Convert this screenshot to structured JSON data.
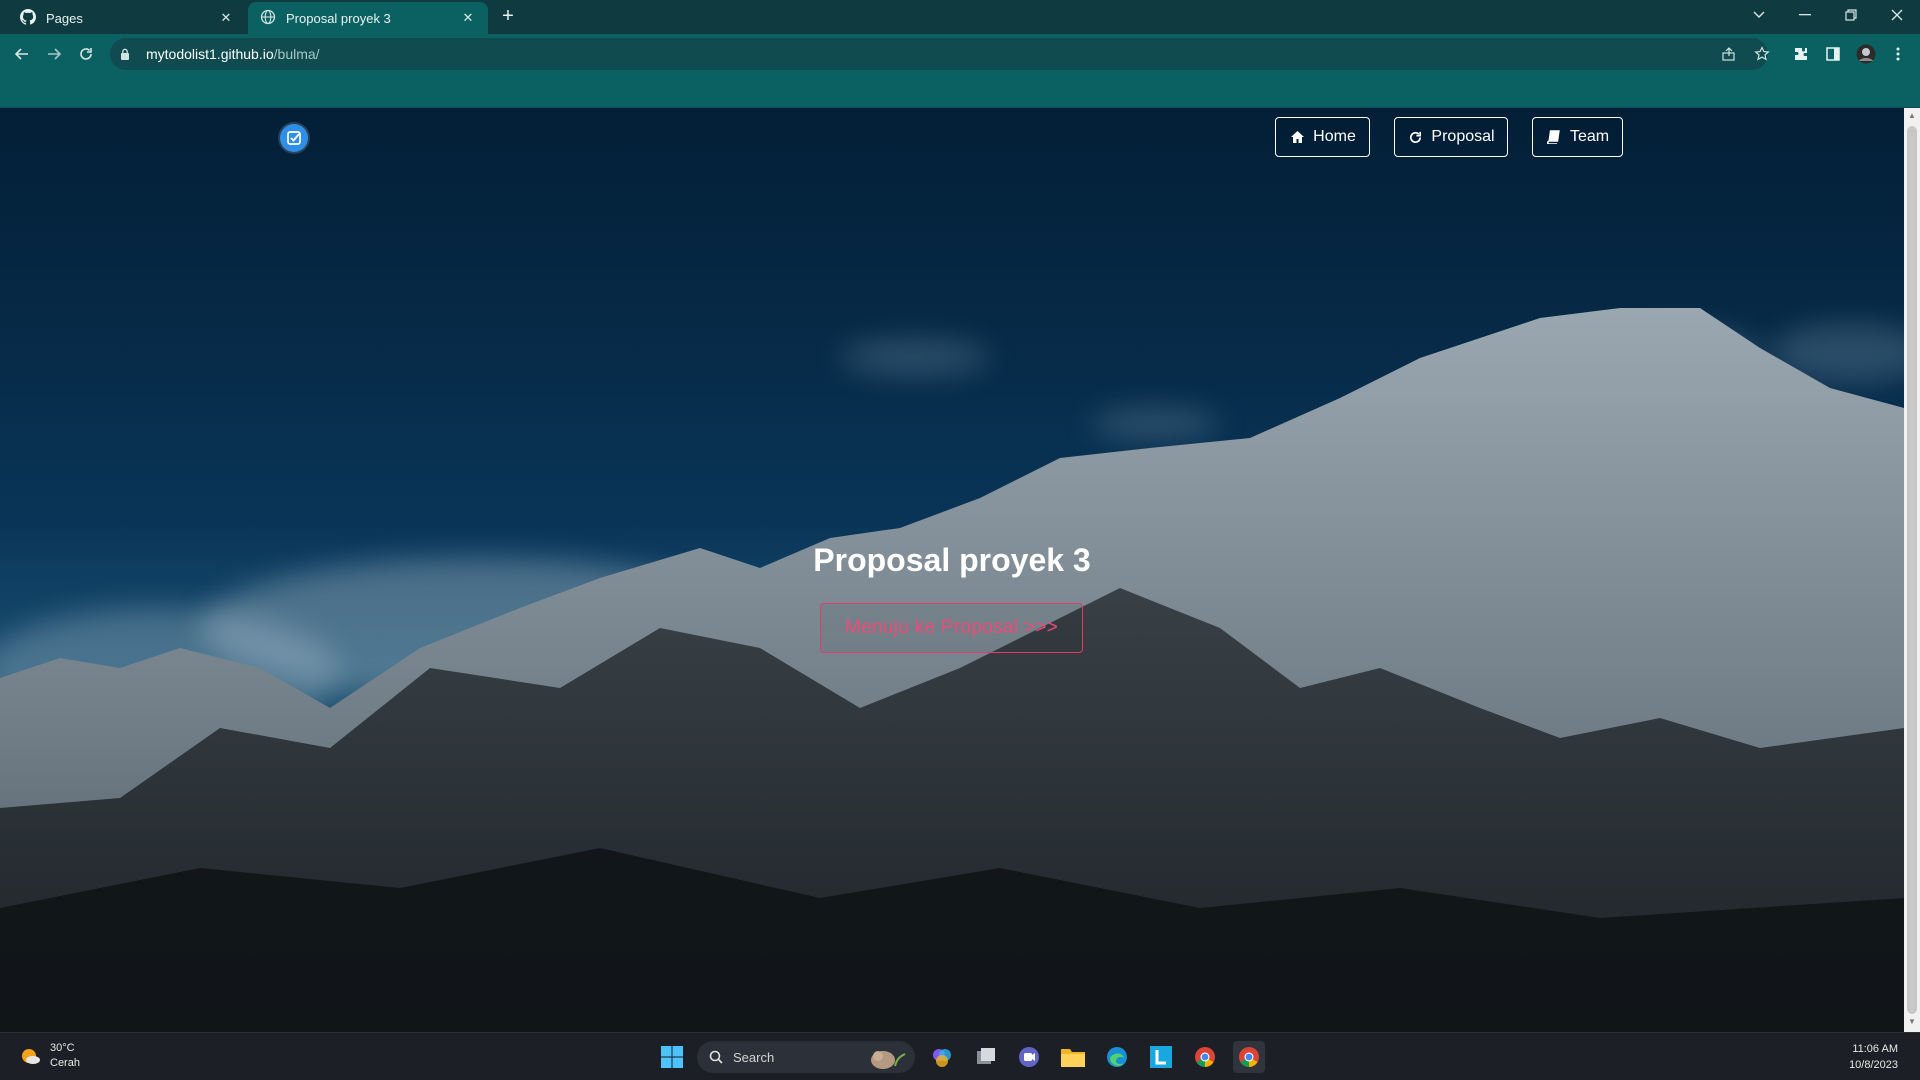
{
  "browser": {
    "tabs": [
      {
        "label": "Pages",
        "active": false
      },
      {
        "label": "Proposal proyek 3",
        "active": true
      }
    ],
    "url_host": "mytodolist1.github.io",
    "url_path": "/bulma/"
  },
  "page": {
    "nav": {
      "home": "Home",
      "proposal": "Proposal",
      "team": "Team"
    },
    "hero_title": "Proposal proyek 3",
    "hero_button": "Menuju ke Proposal >>>",
    "accent_color": "#f14a77",
    "logo_color": "#2f8fe8"
  },
  "taskbar": {
    "weather_temp": "30°C",
    "weather_desc": "Cerah",
    "search_placeholder": "Search",
    "time": "11:06 AM",
    "date": "10/8/2023"
  }
}
